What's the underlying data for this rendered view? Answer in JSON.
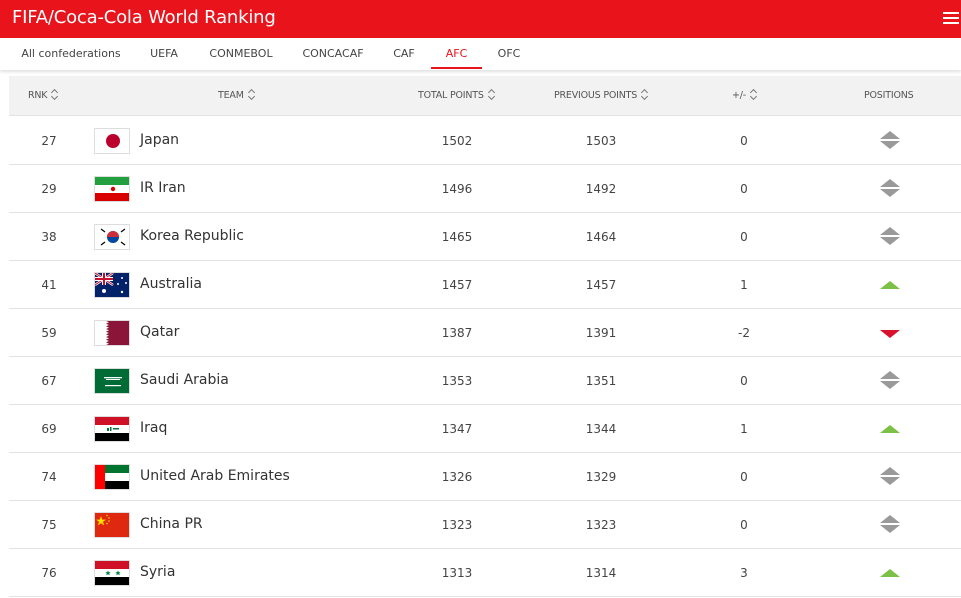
{
  "header": {
    "title": "FIFA/Coca-Cola World Ranking",
    "brand_color": "#e8131b",
    "menu_icon": "hamburger-icon"
  },
  "tabs": [
    {
      "label": "All confederations",
      "active": false
    },
    {
      "label": "UEFA",
      "active": false
    },
    {
      "label": "CONMEBOL",
      "active": false
    },
    {
      "label": "CONCACAF",
      "active": false
    },
    {
      "label": "CAF",
      "active": false
    },
    {
      "label": "AFC",
      "active": true
    },
    {
      "label": "OFC",
      "active": false
    }
  ],
  "columns": {
    "rank": "RNK",
    "team": "TEAM",
    "total_points": "TOTAL POINTS",
    "previous_points": "PREVIOUS POINTS",
    "diff": "+/-",
    "positions": "POSITIONS"
  },
  "colors": {
    "up": "#7cc046",
    "down": "#d8102a",
    "same": "#9a9a9a"
  },
  "rows": [
    {
      "rank": "27",
      "team": "Japan",
      "flag": "japan-flag",
      "total": "1502",
      "previous": "1503",
      "diff": "0",
      "movement": "same"
    },
    {
      "rank": "29",
      "team": "IR Iran",
      "flag": "iran-flag",
      "total": "1496",
      "previous": "1492",
      "diff": "0",
      "movement": "same"
    },
    {
      "rank": "38",
      "team": "Korea Republic",
      "flag": "korea-republic-flag",
      "total": "1465",
      "previous": "1464",
      "diff": "0",
      "movement": "same"
    },
    {
      "rank": "41",
      "team": "Australia",
      "flag": "australia-flag",
      "total": "1457",
      "previous": "1457",
      "diff": "1",
      "movement": "up"
    },
    {
      "rank": "59",
      "team": "Qatar",
      "flag": "qatar-flag",
      "total": "1387",
      "previous": "1391",
      "diff": "-2",
      "movement": "down"
    },
    {
      "rank": "67",
      "team": "Saudi Arabia",
      "flag": "saudi-arabia-flag",
      "total": "1353",
      "previous": "1351",
      "diff": "0",
      "movement": "same"
    },
    {
      "rank": "69",
      "team": "Iraq",
      "flag": "iraq-flag",
      "total": "1347",
      "previous": "1344",
      "diff": "1",
      "movement": "up"
    },
    {
      "rank": "74",
      "team": "United Arab Emirates",
      "flag": "uae-flag",
      "total": "1326",
      "previous": "1329",
      "diff": "0",
      "movement": "same"
    },
    {
      "rank": "75",
      "team": "China PR",
      "flag": "china-flag",
      "total": "1323",
      "previous": "1323",
      "diff": "0",
      "movement": "same"
    },
    {
      "rank": "76",
      "team": "Syria",
      "flag": "syria-flag",
      "total": "1313",
      "previous": "1314",
      "diff": "3",
      "movement": "up"
    }
  ]
}
